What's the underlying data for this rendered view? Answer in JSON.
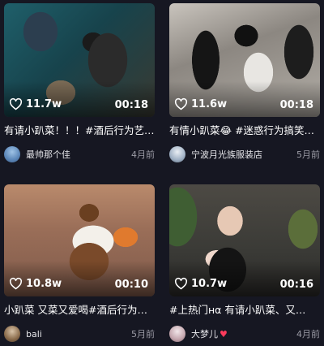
{
  "videos": [
    {
      "likes": "11.7w",
      "duration": "00:18",
      "title": "有请小趴菜！！！#酒后行为艺…",
      "author": "最帅那个佳",
      "time": "4月前"
    },
    {
      "likes": "11.6w",
      "duration": "00:18",
      "title": "有情小趴菜😂 #迷惑行为搞笑…",
      "author": "宁波月光族服装店",
      "time": "5月前"
    },
    {
      "likes": "10.8w",
      "duration": "00:10",
      "title": "小趴菜 又菜又爱喝#酒后行为…",
      "author": "bali",
      "time": "5月前"
    },
    {
      "likes": "10.7w",
      "duration": "00:16",
      "title": "#上热门нα 有请小趴菜、又…",
      "author": "大梦儿",
      "author_badge": "♥",
      "time": "4月前"
    }
  ],
  "icons": {
    "like": "heart-outline-icon",
    "author_badge": "heart-icon"
  },
  "colors": {
    "background": "#161722",
    "badge": "#ff3b5c",
    "secondary_text": "#9b9ba5"
  }
}
